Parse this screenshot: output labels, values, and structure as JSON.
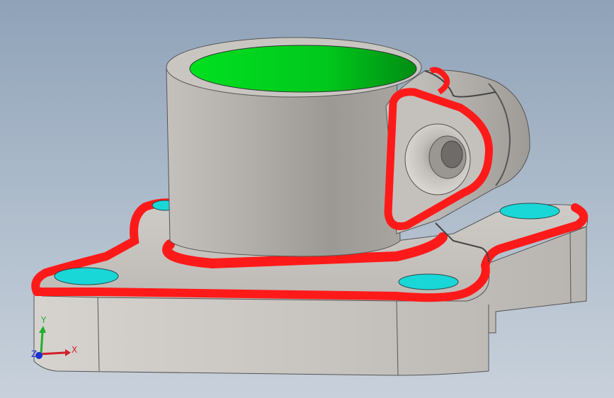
{
  "viewport": {
    "background_top": "#8fa2b8",
    "background_bottom": "#c8d1db"
  },
  "model": {
    "body_color": "#bdbab6",
    "highlight_color": "#ff1a1a",
    "bore_color": "#00d21e",
    "hole_color": "#19d7d7"
  },
  "triad": {
    "x_label": "X",
    "y_label": "Y",
    "z_label": "Z",
    "x_color": "#d0202a",
    "y_color": "#1fb02a",
    "z_color": "#1f2fd6"
  }
}
